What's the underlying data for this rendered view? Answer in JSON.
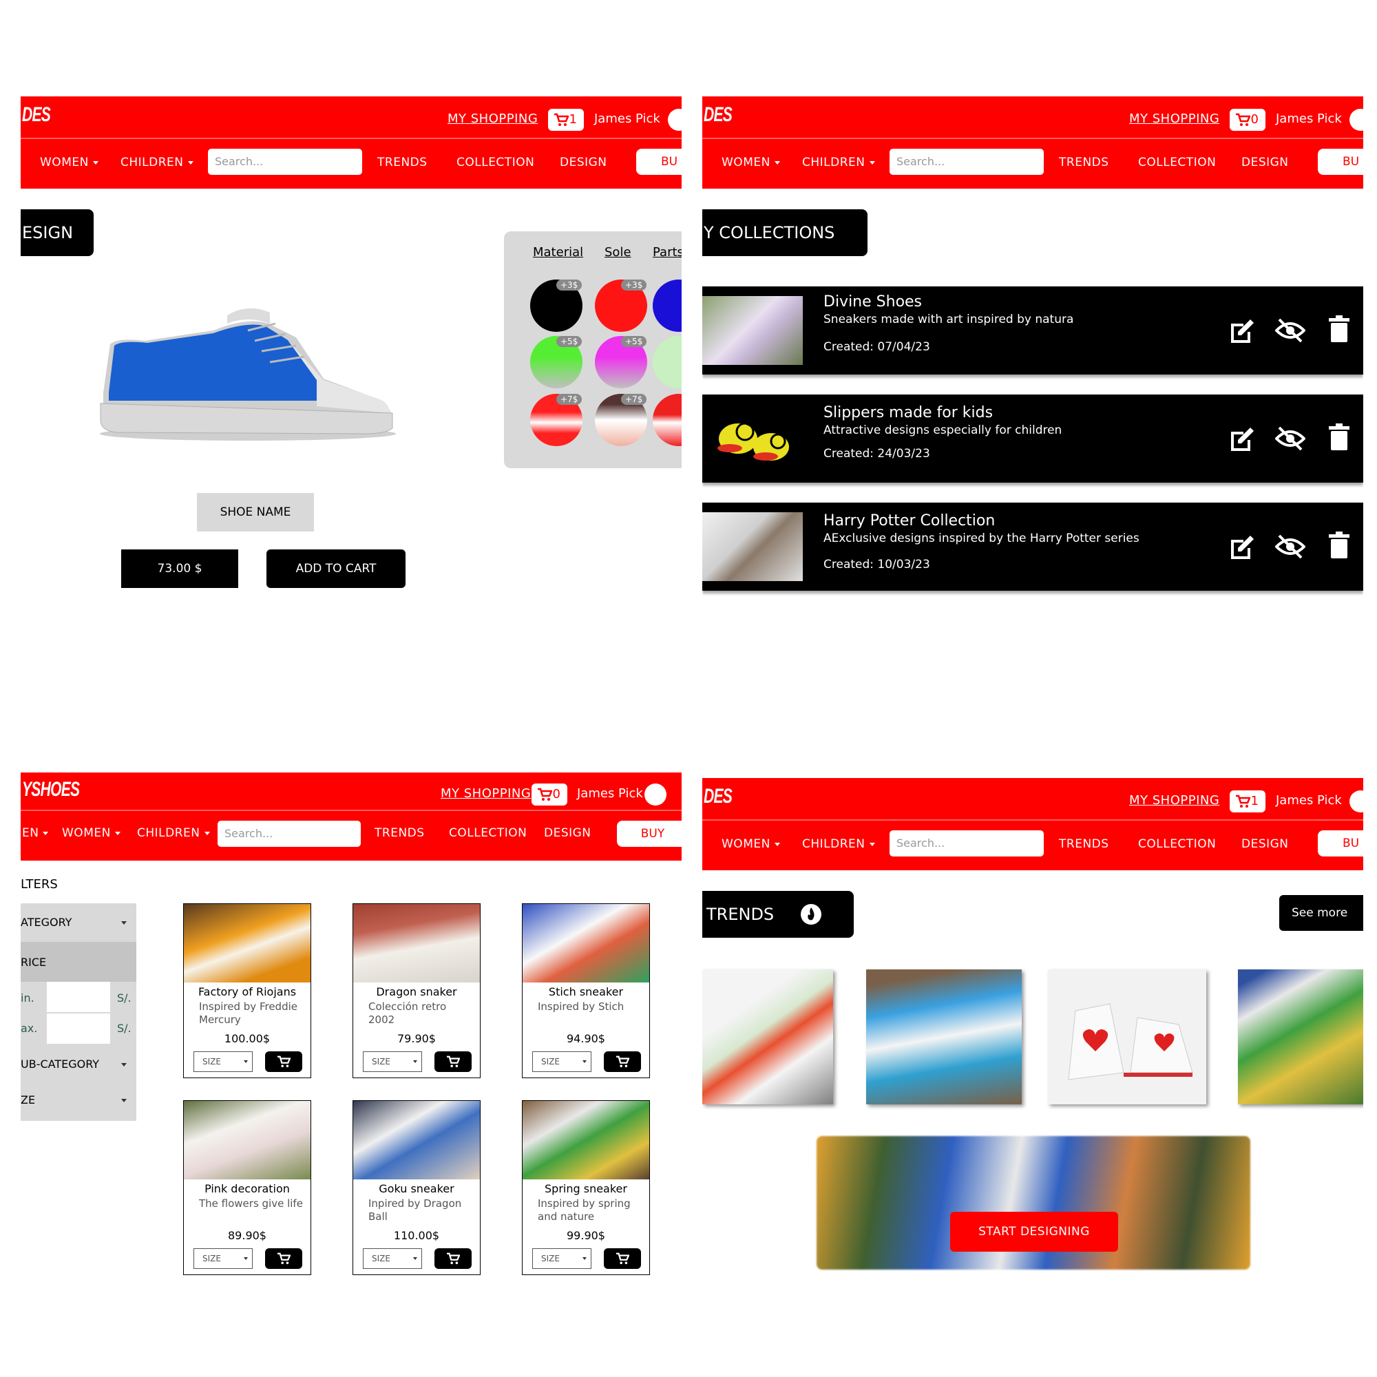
{
  "header": {
    "logo": "DES",
    "logo_full": "YSHOES",
    "my_shopping": "MY SHOPPING",
    "user_name": "James Pick",
    "nav": {
      "men": "EN",
      "women": "WOMEN",
      "children": "CHILDREN",
      "trends": "TRENDS",
      "collection": "COLLECTION",
      "design": "DESIGN",
      "buy": "BUY",
      "buy_cut": "BU"
    },
    "search_placeholder": "Search..."
  },
  "screens": {
    "design": {
      "cart_count": "1",
      "tag": "ESIGN",
      "tabs": [
        "Material",
        "Sole",
        "Parts"
      ],
      "swatches": [
        {
          "color": "#000000",
          "price": "+3$"
        },
        {
          "color": "#ff1414",
          "price": "+3$"
        },
        {
          "color": "#1a0fd6",
          "price": ""
        },
        {
          "color": "#55ee33",
          "price": "+5$"
        },
        {
          "color": "#ee33ee",
          "price": "+5$"
        },
        {
          "color": "#c8f0c0",
          "price": ""
        },
        {
          "color": "#ff2020",
          "price": "+7$"
        },
        {
          "color": "#553333",
          "price": "+7$"
        },
        {
          "color": "#ee2020",
          "price": ""
        }
      ],
      "shoe_name": "SHOE NAME",
      "price": "73.00  $",
      "add_to_cart": "ADD TO CART"
    },
    "collections": {
      "cart_count": "0",
      "tag": "Y COLLECTIONS",
      "items": [
        {
          "title": "Divine Shoes",
          "desc": "Sneakers made with art inspired by natura",
          "created": "Created: 07/04/23"
        },
        {
          "title": "Slippers made for kids",
          "desc": "Attractive designs especially for children",
          "created": "Created: 24/03/23"
        },
        {
          "title": "Harry Potter Collection",
          "desc": "AExclusive designs inspired by the Harry Potter series",
          "created": "Created: 10/03/23"
        }
      ]
    },
    "catalog": {
      "cart_count": "0",
      "filters_title": "LTERS",
      "filters": {
        "category": "ATEGORY",
        "price": "RICE",
        "min": "in.",
        "max": "ax.",
        "currency": "S/.",
        "subcategory": "UB-CATEGORY",
        "size": "ZE"
      },
      "size_label": "SIZE",
      "products": [
        {
          "name": "Factory of Riojans",
          "desc": "Inspired by Freddie Mercury",
          "price": "100.00$"
        },
        {
          "name": "Dragon snaker",
          "desc": "Colección retro 2002",
          "price": "79.90$"
        },
        {
          "name": "Stich sneaker",
          "desc": "Inspired by Stich",
          "price": "94.90$"
        },
        {
          "name": "Pink decoration",
          "desc": "The flowers give life",
          "price": "89.90$"
        },
        {
          "name": "Goku sneaker",
          "desc": "Inpired by Dragon Ball",
          "price": "110.00$"
        },
        {
          "name": "Spring sneaker",
          "desc": "Inspired by spring and nature",
          "price": "99.90$"
        }
      ]
    },
    "trends": {
      "cart_count": "1",
      "tag": "TRENDS",
      "see_more": "See more",
      "start_designing": "START DESIGNING"
    }
  },
  "colors": {
    "brand_red": "#ff0000",
    "black": "#000000",
    "panel_grey": "#d9d9d9"
  }
}
